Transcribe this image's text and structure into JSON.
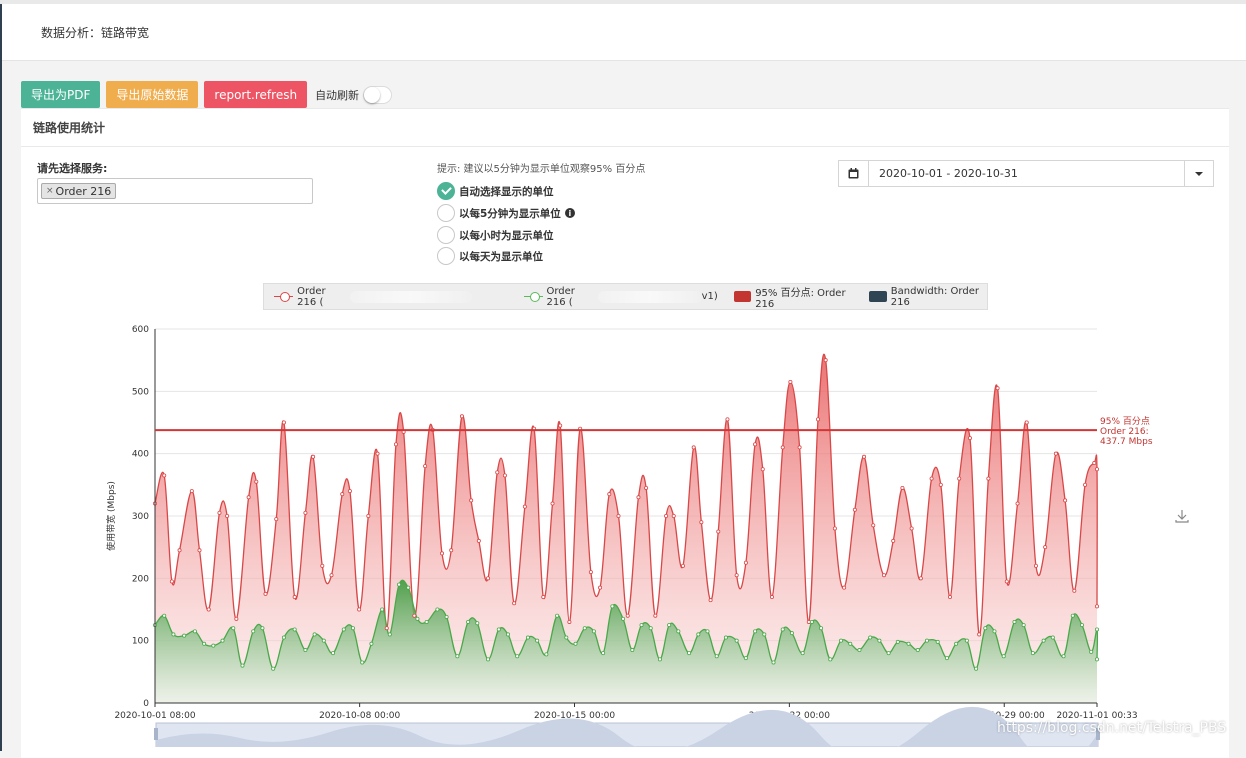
{
  "header": {
    "title": "数据分析：链路带宽"
  },
  "toolbar": {
    "export_pdf": "导出为PDF",
    "export_raw": "导出原始数据",
    "refresh": "report.refresh",
    "auto_refresh_label": "自动刷新",
    "auto_refresh_on": false
  },
  "panel": {
    "title": "链路使用统计",
    "service_label": "请先选择服务:",
    "selected_service": "Order 216",
    "hint": "提示: 建议以5分钟为显示单位观察95% 百分点",
    "radios": [
      {
        "label": "自动选择显示的单位",
        "checked": true
      },
      {
        "label": "以每5分钟为显示单位",
        "checked": false,
        "info": true
      },
      {
        "label": "以每小时为显示单位",
        "checked": false
      },
      {
        "label": "以每天为显示单位",
        "checked": false
      }
    ],
    "date_range": "2020-10-01 - 2020-10-31"
  },
  "legend": {
    "items": [
      {
        "label_start": "Order 216 (",
        "label_end": "",
        "type": "line",
        "color": "#d94848"
      },
      {
        "label_start": "Order 216 (",
        "label_end": "v1)",
        "type": "line",
        "color": "#5cb85c"
      },
      {
        "label": "95% 百分点: Order 216",
        "type": "box",
        "color": "#c23531"
      },
      {
        "label": "Bandwidth: Order 216",
        "type": "box",
        "color": "#2f4554"
      }
    ]
  },
  "watermark": "https://blog.csdn.net/Telstra_PBS",
  "colors": {
    "inbound": "#d94848",
    "outbound": "#4aa84a",
    "percentile": "#d23636",
    "accent": "#4cb396"
  },
  "chart_data": {
    "type": "area",
    "ylabel": "使用带宽 (Mbps)",
    "ylim": [
      0,
      600
    ],
    "yticks": [
      0,
      100,
      200,
      300,
      400,
      500,
      600
    ],
    "grid": true,
    "x_ticks": [
      "2020-10-01 08:00",
      "2020-10-08 00:00",
      "2020-10-15 00:00",
      "2020-10-22 00:00",
      "2020-10-29 00:00",
      "2020-11-01 00:33"
    ],
    "x_tick_days": [
      0,
      6.667,
      13.667,
      20.667,
      27.667,
      30.689
    ],
    "x_range_days": [
      0,
      30.689
    ],
    "percentile_label": [
      "95% 百分点",
      "Order 216:",
      "437.7 Mbps"
    ],
    "percentile_value": 437.7,
    "series": [
      {
        "name": "inbound",
        "points": [
          [
            0,
            320
          ],
          [
            0.3,
            365
          ],
          [
            0.55,
            195
          ],
          [
            0.8,
            245
          ],
          [
            1.2,
            340
          ],
          [
            1.45,
            245
          ],
          [
            1.75,
            150
          ],
          [
            2.1,
            305
          ],
          [
            2.35,
            300
          ],
          [
            2.65,
            135
          ],
          [
            3.05,
            330
          ],
          [
            3.3,
            355
          ],
          [
            3.6,
            175
          ],
          [
            3.95,
            295
          ],
          [
            4.2,
            450
          ],
          [
            4.55,
            170
          ],
          [
            4.9,
            305
          ],
          [
            5.15,
            395
          ],
          [
            5.45,
            220
          ],
          [
            5.75,
            205
          ],
          [
            6.1,
            335
          ],
          [
            6.35,
            340
          ],
          [
            6.65,
            150
          ],
          [
            6.95,
            300
          ],
          [
            7.25,
            400
          ],
          [
            7.55,
            120
          ],
          [
            7.85,
            415
          ],
          [
            8.1,
            435
          ],
          [
            8.45,
            140
          ],
          [
            8.8,
            380
          ],
          [
            9.05,
            438
          ],
          [
            9.35,
            240
          ],
          [
            9.65,
            245
          ],
          [
            10.0,
            460
          ],
          [
            10.3,
            325
          ],
          [
            10.55,
            260
          ],
          [
            10.85,
            200
          ],
          [
            11.15,
            370
          ],
          [
            11.4,
            365
          ],
          [
            11.7,
            160
          ],
          [
            12.05,
            315
          ],
          [
            12.35,
            440
          ],
          [
            12.65,
            170
          ],
          [
            12.95,
            320
          ],
          [
            13.2,
            445
          ],
          [
            13.5,
            130
          ],
          [
            13.85,
            440
          ],
          [
            14.2,
            210
          ],
          [
            14.5,
            185
          ],
          [
            14.8,
            335
          ],
          [
            15.1,
            300
          ],
          [
            15.4,
            140
          ],
          [
            15.75,
            330
          ],
          [
            16.0,
            345
          ],
          [
            16.3,
            140
          ],
          [
            16.65,
            300
          ],
          [
            16.9,
            300
          ],
          [
            17.2,
            220
          ],
          [
            17.55,
            410
          ],
          [
            17.8,
            290
          ],
          [
            18.1,
            165
          ],
          [
            18.35,
            275
          ],
          [
            18.65,
            455
          ],
          [
            18.95,
            205
          ],
          [
            19.25,
            225
          ],
          [
            19.55,
            415
          ],
          [
            19.8,
            375
          ],
          [
            20.1,
            170
          ],
          [
            20.45,
            410
          ],
          [
            20.7,
            515
          ],
          [
            21.0,
            410
          ],
          [
            21.3,
            130
          ],
          [
            21.6,
            455
          ],
          [
            21.85,
            550
          ],
          [
            22.15,
            280
          ],
          [
            22.45,
            185
          ],
          [
            22.8,
            310
          ],
          [
            23.1,
            395
          ],
          [
            23.4,
            285
          ],
          [
            23.75,
            205
          ],
          [
            24.05,
            260
          ],
          [
            24.35,
            345
          ],
          [
            24.65,
            280
          ],
          [
            24.95,
            200
          ],
          [
            25.3,
            360
          ],
          [
            25.6,
            350
          ],
          [
            25.9,
            170
          ],
          [
            26.2,
            360
          ],
          [
            26.55,
            425
          ],
          [
            26.85,
            110
          ],
          [
            27.15,
            360
          ],
          [
            27.45,
            505
          ],
          [
            27.75,
            195
          ],
          [
            28.1,
            320
          ],
          [
            28.4,
            450
          ],
          [
            28.7,
            220
          ],
          [
            29.0,
            250
          ],
          [
            29.35,
            400
          ],
          [
            29.65,
            325
          ],
          [
            29.95,
            180
          ],
          [
            30.3,
            350
          ],
          [
            30.6,
            385
          ],
          [
            30.9,
            375
          ],
          [
            31.2,
            155
          ]
        ]
      },
      {
        "name": "outbound",
        "points": [
          [
            0,
            125
          ],
          [
            0.3,
            140
          ],
          [
            0.6,
            110
          ],
          [
            0.95,
            108
          ],
          [
            1.3,
            115
          ],
          [
            1.6,
            95
          ],
          [
            1.9,
            92
          ],
          [
            2.2,
            100
          ],
          [
            2.55,
            120
          ],
          [
            2.85,
            60
          ],
          [
            3.2,
            115
          ],
          [
            3.5,
            120
          ],
          [
            3.85,
            55
          ],
          [
            4.2,
            105
          ],
          [
            4.55,
            118
          ],
          [
            4.9,
            85
          ],
          [
            5.2,
            110
          ],
          [
            5.5,
            100
          ],
          [
            5.8,
            80
          ],
          [
            6.15,
            118
          ],
          [
            6.45,
            120
          ],
          [
            6.75,
            65
          ],
          [
            7.05,
            95
          ],
          [
            7.4,
            150
          ],
          [
            7.65,
            110
          ],
          [
            7.95,
            190
          ],
          [
            8.25,
            185
          ],
          [
            8.55,
            135
          ],
          [
            8.85,
            130
          ],
          [
            9.2,
            150
          ],
          [
            9.5,
            138
          ],
          [
            9.85,
            75
          ],
          [
            10.2,
            130
          ],
          [
            10.5,
            128
          ],
          [
            10.85,
            70
          ],
          [
            11.2,
            118
          ],
          [
            11.5,
            110
          ],
          [
            11.8,
            75
          ],
          [
            12.15,
            105
          ],
          [
            12.45,
            100
          ],
          [
            12.75,
            78
          ],
          [
            13.1,
            140
          ],
          [
            13.4,
            105
          ],
          [
            13.7,
            95
          ],
          [
            14.0,
            120
          ],
          [
            14.3,
            115
          ],
          [
            14.6,
            80
          ],
          [
            14.9,
            155
          ],
          [
            15.25,
            135
          ],
          [
            15.55,
            85
          ],
          [
            15.85,
            125
          ],
          [
            16.15,
            120
          ],
          [
            16.45,
            70
          ],
          [
            16.75,
            125
          ],
          [
            17.05,
            115
          ],
          [
            17.4,
            80
          ],
          [
            17.7,
            110
          ],
          [
            18.0,
            115
          ],
          [
            18.3,
            75
          ],
          [
            18.6,
            105
          ],
          [
            18.95,
            100
          ],
          [
            19.25,
            72
          ],
          [
            19.55,
            115
          ],
          [
            19.85,
            110
          ],
          [
            20.15,
            65
          ],
          [
            20.45,
            118
          ],
          [
            20.75,
            112
          ],
          [
            21.1,
            80
          ],
          [
            21.4,
            130
          ],
          [
            21.7,
            120
          ],
          [
            22.0,
            70
          ],
          [
            22.35,
            100
          ],
          [
            22.65,
            95
          ],
          [
            22.95,
            85
          ],
          [
            23.3,
            105
          ],
          [
            23.6,
            100
          ],
          [
            23.9,
            80
          ],
          [
            24.2,
            98
          ],
          [
            24.55,
            95
          ],
          [
            24.85,
            85
          ],
          [
            25.15,
            100
          ],
          [
            25.5,
            98
          ],
          [
            25.8,
            72
          ],
          [
            26.1,
            95
          ],
          [
            26.45,
            100
          ],
          [
            26.75,
            55
          ],
          [
            27.05,
            120
          ],
          [
            27.35,
            115
          ],
          [
            27.65,
            75
          ],
          [
            28.0,
            130
          ],
          [
            28.3,
            125
          ],
          [
            28.6,
            80
          ],
          [
            28.95,
            100
          ],
          [
            29.25,
            105
          ],
          [
            29.6,
            75
          ],
          [
            29.9,
            140
          ],
          [
            30.2,
            125
          ],
          [
            30.5,
            82
          ],
          [
            30.85,
            118
          ],
          [
            31.2,
            70
          ]
        ]
      }
    ]
  }
}
